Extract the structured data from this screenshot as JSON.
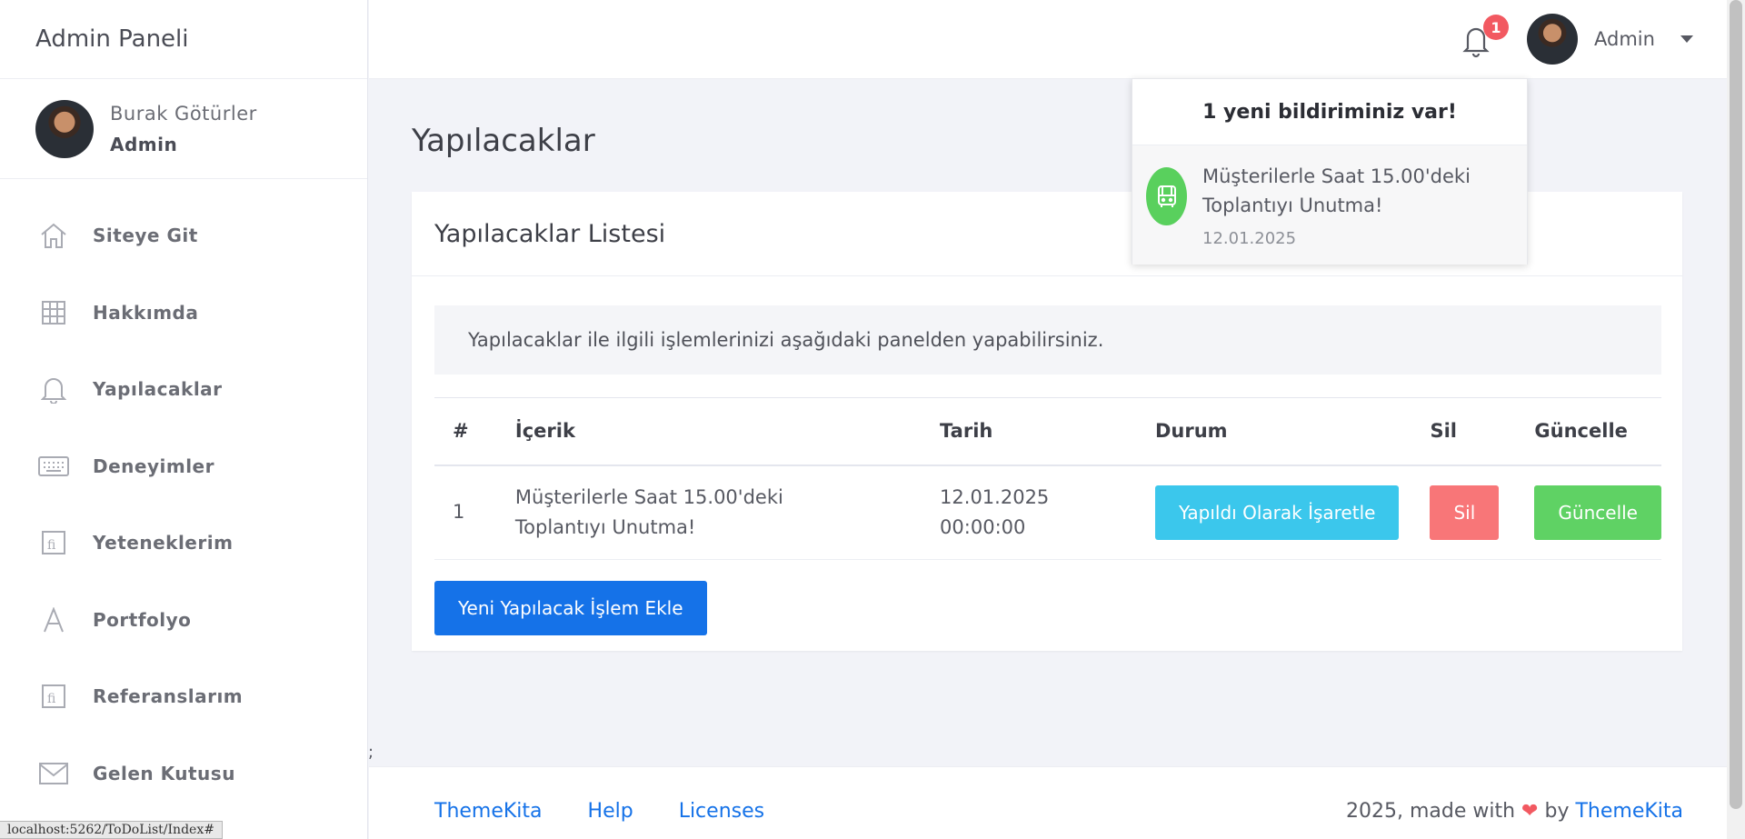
{
  "app": {
    "title": "Admin Paneli"
  },
  "sidebar": {
    "user": {
      "name": "Burak Götürler",
      "role": "Admin"
    },
    "items": [
      {
        "label": "Siteye Git",
        "icon": "home-icon"
      },
      {
        "label": "Hakkımda",
        "icon": "grid-icon"
      },
      {
        "label": "Yapılacaklar",
        "icon": "bell-icon"
      },
      {
        "label": "Deneyimler",
        "icon": "keyboard-icon"
      },
      {
        "label": "Yeteneklerim",
        "icon": "fi-icon"
      },
      {
        "label": "Portfolyo",
        "icon": "letter-a-icon"
      },
      {
        "label": "Referanslarım",
        "icon": "fi-icon"
      },
      {
        "label": "Gelen Kutusu",
        "icon": "envelope-icon"
      }
    ]
  },
  "header": {
    "notification_count": "1",
    "user_name": "Admin"
  },
  "notifications": {
    "title": "1 yeni bildiriminiz var!",
    "items": [
      {
        "message": "Müşterilerle Saat 15.00'deki Toplantıyı Unutma!",
        "time": "12.01.2025",
        "icon": "bus-icon"
      }
    ]
  },
  "page": {
    "title": "Yapılacaklar",
    "card_title": "Yapılacaklar Listesi",
    "info": "Yapılacaklar ile ilgili işlemlerinizi aşağıdaki panelden yapabilirsiniz.",
    "table": {
      "headers": [
        "#",
        "İçerik",
        "Tarih",
        "Durum",
        "Sil",
        "Güncelle"
      ],
      "rows": [
        {
          "num": "1",
          "content": "Müşterilerle Saat 15.00'deki Toplantıyı Unutma!",
          "date": "12.01.2025 00:00:00",
          "status_btn": "Yapıldı Olarak İşaretle",
          "delete_btn": "Sil",
          "update_btn": "Güncelle"
        }
      ]
    },
    "add_button": "Yeni Yapılacak İşlem Ekle"
  },
  "footer": {
    "links": [
      "ThemeKita",
      "Help",
      "Licenses"
    ],
    "made_with": "2025, made with",
    "by": "by",
    "brand": "ThemeKita"
  },
  "status_bar": "localhost:5262/ToDoList/Index#",
  "stray_text": ";"
}
